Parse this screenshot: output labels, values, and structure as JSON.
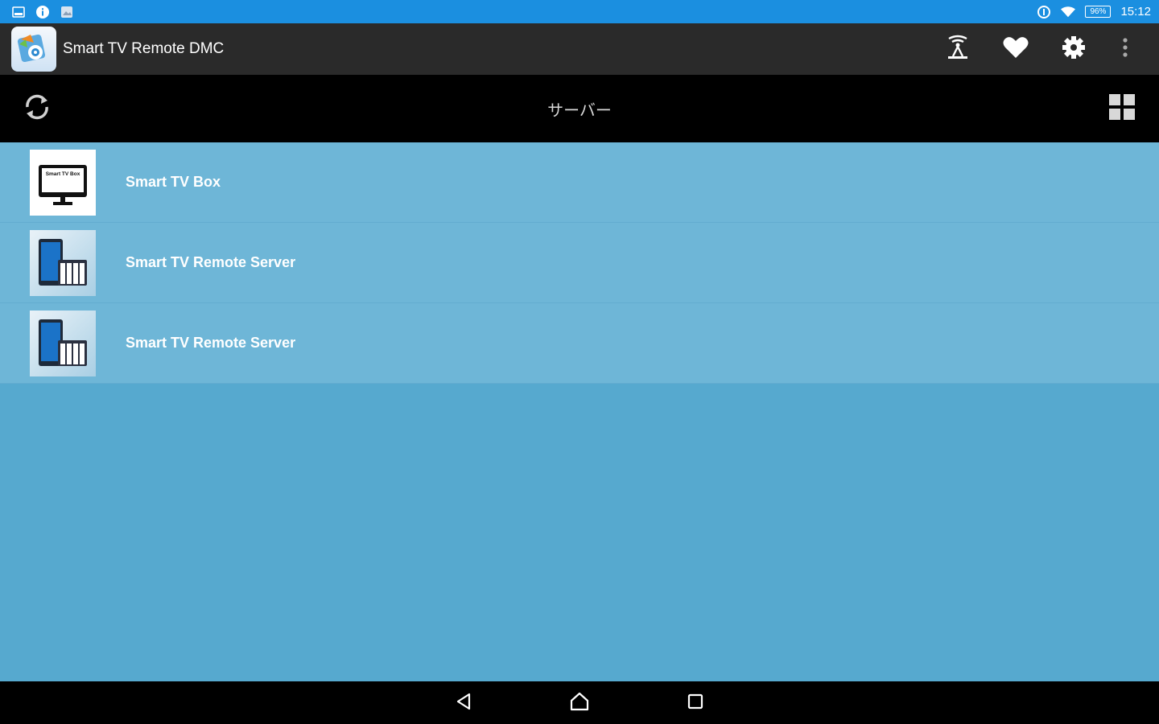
{
  "status_bar": {
    "left_icons": [
      "screenshot-icon",
      "info-icon",
      "image-icon"
    ],
    "right_icons": [
      "data-saver-icon",
      "wifi-icon"
    ],
    "battery": "96%",
    "time": "15:12"
  },
  "app_bar": {
    "title": "Smart TV Remote DMC",
    "actions": [
      "cast-icon",
      "heart-icon",
      "gear-icon",
      "more-icon"
    ]
  },
  "section": {
    "title": "サーバー"
  },
  "servers": [
    {
      "name": "Smart TV Box",
      "thumb_label": "Smart TV Box",
      "icon": "tv-icon"
    },
    {
      "name": "Smart TV Remote Server",
      "icon": "device-icon"
    },
    {
      "name": "Smart TV Remote Server",
      "icon": "device-icon"
    }
  ],
  "colors": {
    "status_bar": "#1b8fe0",
    "app_bar": "#2a2a2a",
    "list_item": "#6eb6d7",
    "background": "#56a9cf"
  }
}
